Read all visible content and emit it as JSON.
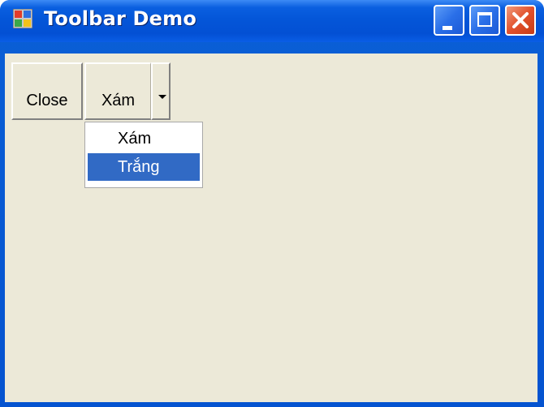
{
  "window": {
    "title": "Toolbar Demo"
  },
  "icons": {
    "app": "app-icon",
    "minimize": "minimize-icon",
    "maximize": "maximize-icon",
    "close": "close-icon",
    "dropdown": "chevron-down-icon"
  },
  "toolbar": {
    "close_label": "Close",
    "color_label": "Xám",
    "menu_items": [
      "Xám",
      "Trắng"
    ],
    "selected_menu_index": 1
  },
  "colors": {
    "titlebar_blue": "#0456d8",
    "client_bg": "#ece9d8",
    "menu_highlight": "#316ac5",
    "close_button_red": "#e2512c"
  }
}
